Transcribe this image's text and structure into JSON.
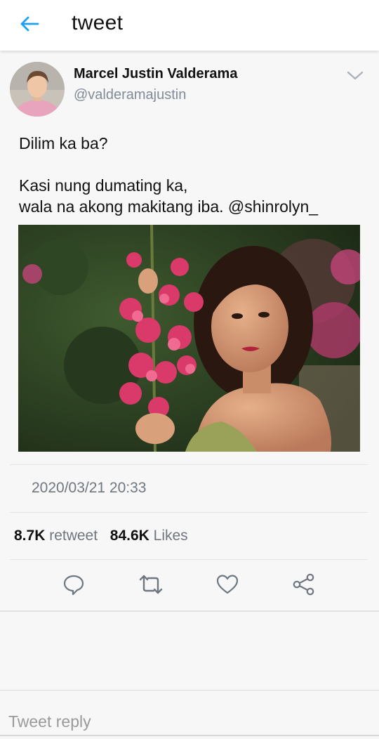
{
  "header": {
    "title": "tweet",
    "back_icon": "arrow-left-icon",
    "accent_color": "#1da1f2"
  },
  "tweet": {
    "author": {
      "name": "Marcel Justin Valderama",
      "handle": "@valderamajustin"
    },
    "menu_icon": "chevron-down-icon",
    "text_lines": [
      "Dilim ka ba?",
      "Kasi nung dumating ka,",
      "wala na akong makitang iba. @shinrolyn_"
    ],
    "timestamp": "2020/03/21 20:33",
    "stats": {
      "retweets": "8.7K",
      "retweets_label": "retweet",
      "likes": "84.6K",
      "likes_label": "Likes"
    },
    "actions": [
      {
        "name": "reply",
        "icon": "comment-icon"
      },
      {
        "name": "retweet",
        "icon": "retweet-icon"
      },
      {
        "name": "like",
        "icon": "heart-icon"
      },
      {
        "name": "share",
        "icon": "share-icon"
      }
    ]
  },
  "reply": {
    "placeholder": "Tweet reply"
  }
}
